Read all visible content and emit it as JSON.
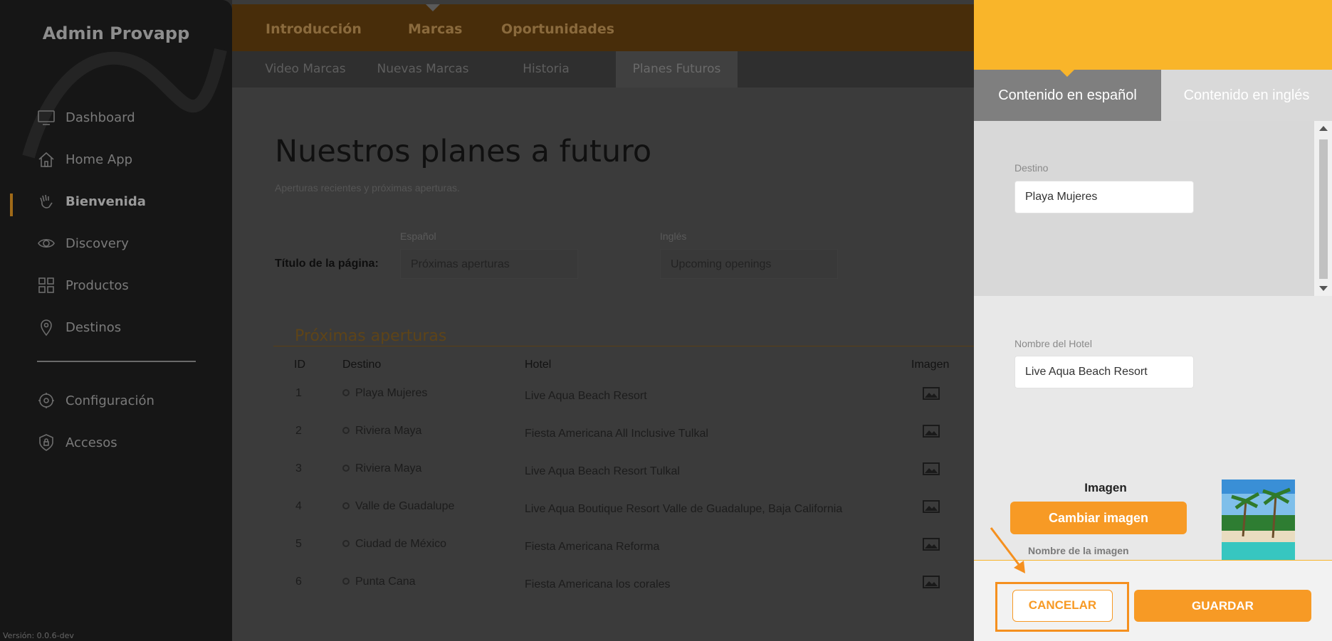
{
  "sidebar": {
    "app_title": "Admin Provapp",
    "items": [
      {
        "label": "Dashboard",
        "icon": "monitor-icon"
      },
      {
        "label": "Home App",
        "icon": "home-icon"
      },
      {
        "label": "Bienvenida",
        "icon": "wave-hand-icon",
        "active": true
      },
      {
        "label": "Discovery",
        "icon": "eye-icon"
      },
      {
        "label": "Productos",
        "icon": "grid-icon"
      },
      {
        "label": "Destinos",
        "icon": "map-pin-icon"
      },
      {
        "label": "Configuración",
        "icon": "gear-icon"
      },
      {
        "label": "Accesos",
        "icon": "shield-lock-icon"
      }
    ],
    "version": "Versión: 0.0.6-dev"
  },
  "topnav": {
    "items": [
      "Introducción",
      "Marcas",
      "Oportunidades"
    ],
    "active": "Marcas"
  },
  "subnav": {
    "items": [
      "Video Marcas",
      "Nuevas Marcas",
      "Historia",
      "Planes Futuros"
    ],
    "active": "Planes Futuros"
  },
  "page": {
    "heading": "Nuestros planes a futuro",
    "subheading": "Aperturas recientes y próximas aperturas.",
    "title_label": "Título de la página:",
    "spanish_label": "Español",
    "english_label": "Inglés",
    "title_es": "Próximas aperturas",
    "title_en": "Upcoming openings",
    "section_title": "Próximas aperturas"
  },
  "table": {
    "headers": [
      "ID",
      "Destino",
      "Hotel",
      "Imagen"
    ],
    "rows": [
      {
        "id": "1",
        "destino": "Playa Mujeres",
        "hotel": "Live Aqua Beach Resort"
      },
      {
        "id": "2",
        "destino": "Riviera Maya",
        "hotel": "Fiesta Americana All Inclusive Tulkal"
      },
      {
        "id": "3",
        "destino": "Riviera Maya",
        "hotel": "Live Aqua Beach Resort Tulkal"
      },
      {
        "id": "4",
        "destino": "Valle de Guadalupe",
        "hotel": "Live Aqua Boutique Resort Valle de Guadalupe, Baja California"
      },
      {
        "id": "5",
        "destino": "Ciudad de México",
        "hotel": "Fiesta Americana Reforma"
      },
      {
        "id": "6",
        "destino": "Punta Cana",
        "hotel": "Fiesta Americana los corales"
      }
    ]
  },
  "panel": {
    "tab_es": "Contenido en español",
    "tab_en": "Contenido en inglés",
    "destino_label": "Destino",
    "destino_value": "Playa Mujeres",
    "hotel_label": "Nombre del Hotel",
    "hotel_value": "Live Aqua Beach Resort",
    "image_heading": "Imagen",
    "change_image": "Cambiar imagen",
    "image_name_label": "Nombre de la imagen",
    "cancel": "CANCELAR",
    "save": "GUARDAR"
  },
  "colors": {
    "accent": "#f79a25",
    "header_yellow": "#f9b52a"
  }
}
